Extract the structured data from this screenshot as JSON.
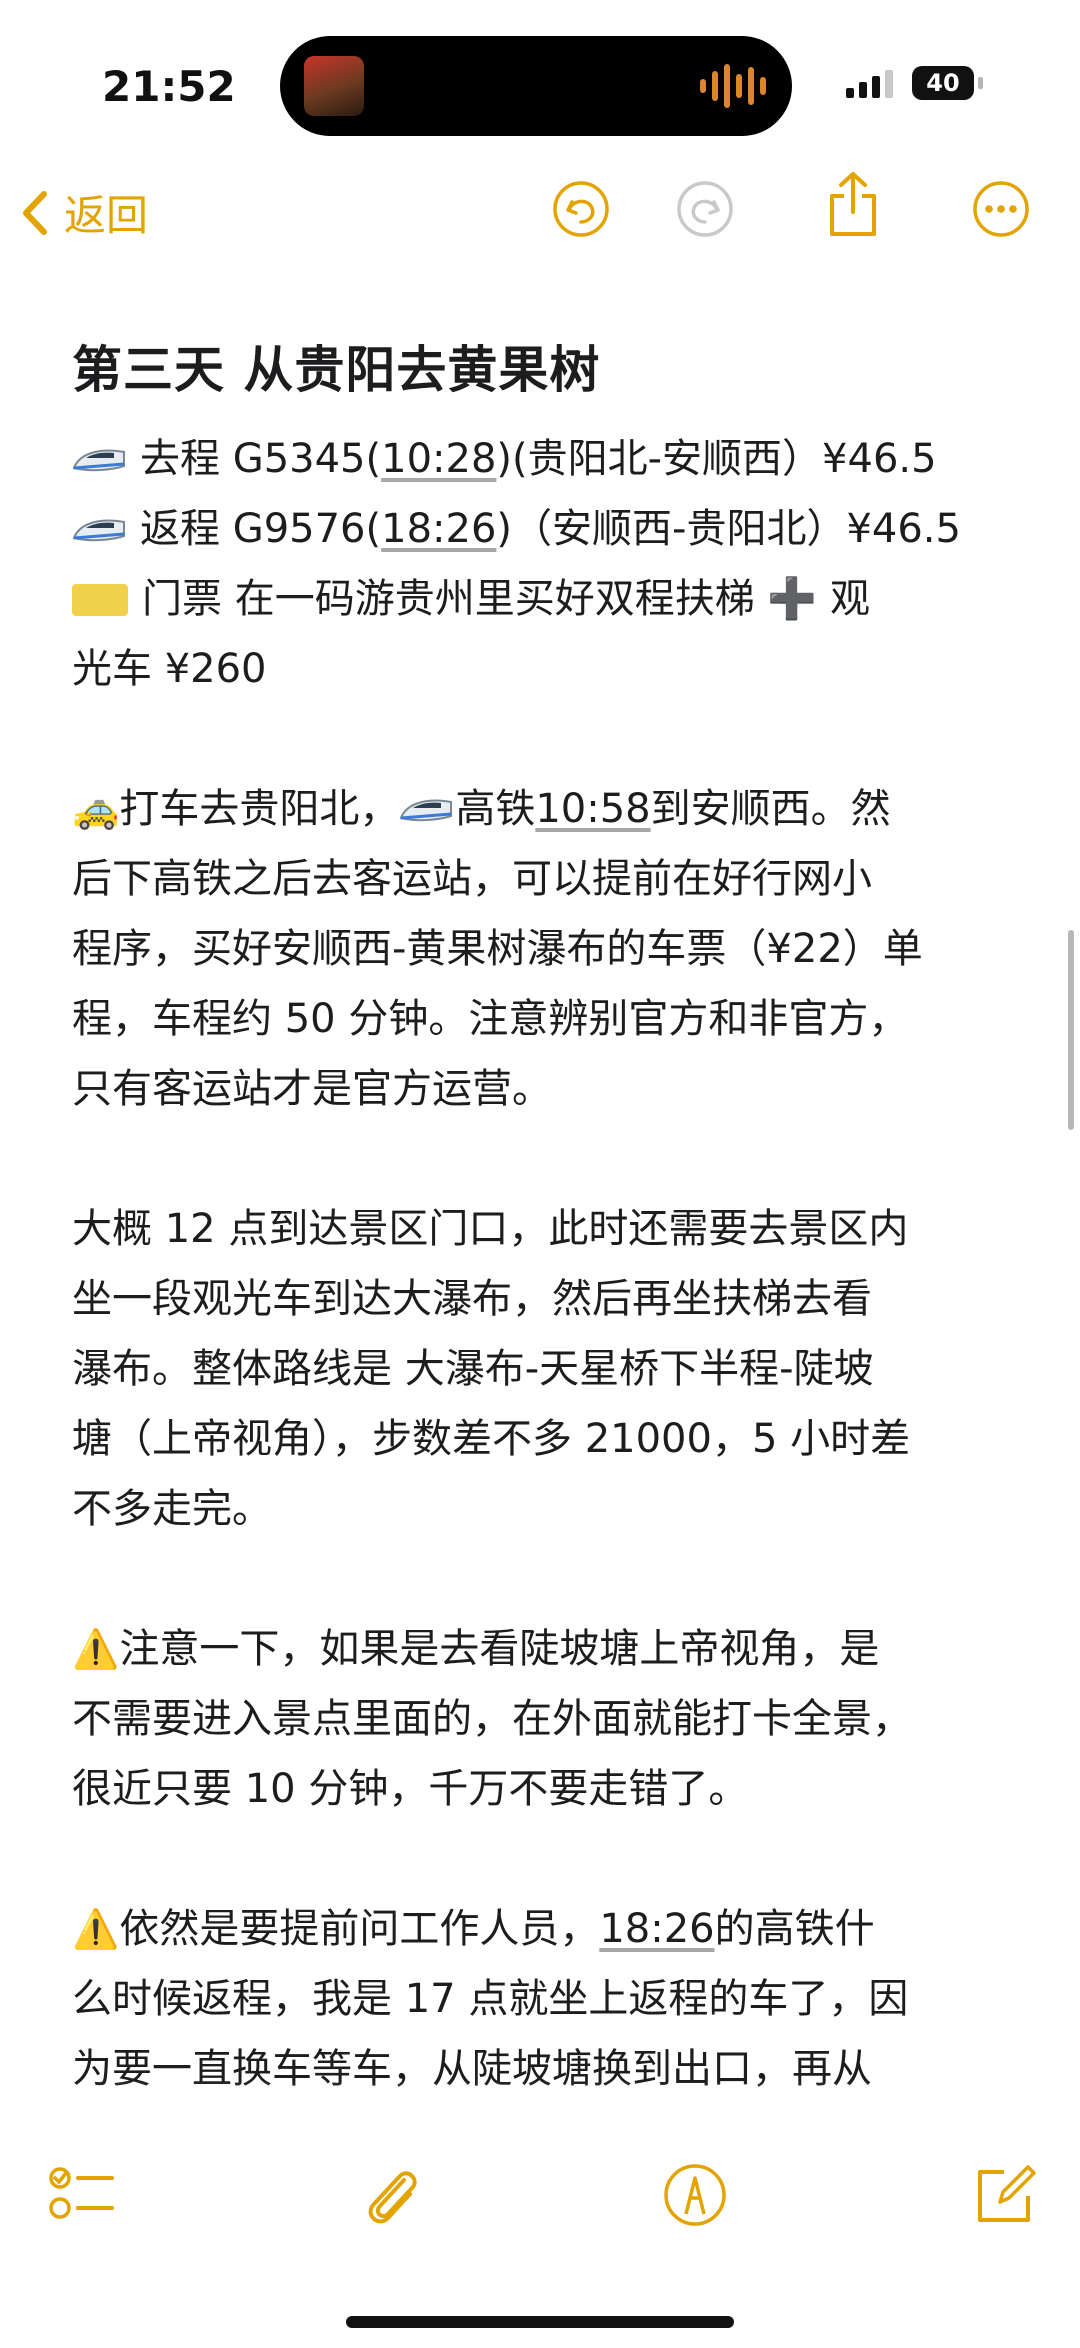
{
  "status_bar": {
    "time": "21:52",
    "battery": "40"
  },
  "nav": {
    "back_label": "返回",
    "icons": [
      "chevron-left-icon",
      "undo-icon",
      "redo-icon",
      "share-icon",
      "more-icon"
    ]
  },
  "note": {
    "title": "第三天 从贵阳去黄果树",
    "outbound": {
      "prefix": "去程 G5345(",
      "time": "10:28",
      "suffix": ")(贵阳北-安顺西）¥46.5"
    },
    "return": {
      "prefix": "返程 G9576(",
      "time": "18:26",
      "suffix": ")（安顺西-贵阳北）¥46.5"
    },
    "ticket_line1": "门票 在一码游贵州里买好双程扶梯 ➕ 观",
    "ticket_line2": "光车 ¥260",
    "p1": {
      "l1a": "打车去贵阳北，",
      "l1b": "高铁",
      "l1time": "10:58",
      "l1c": "到安顺西。然",
      "l2": "后下高铁之后去客运站，可以提前在好行网小",
      "l3": "程序，买好安顺西-黄果树瀑布的车票（¥22）单",
      "l4": "程，车程约 50 分钟。注意辨别官方和非官方，",
      "l5": "只有客运站才是官方运营。"
    },
    "p2": {
      "l1": "大概 12 点到达景区门口，此时还需要去景区内",
      "l2": "坐一段观光车到达大瀑布，然后再坐扶梯去看",
      "l3": "瀑布。整体路线是 大瀑布-天星桥下半程-陡坡",
      "l4": "塘（上帝视角），步数差不多 21000，5 小时差",
      "l5": "不多走完。"
    },
    "p3": {
      "l1": "注意一下，如果是去看陡坡塘上帝视角，是",
      "l2": "不需要进入景点里面的，在外面就能打卡全景，",
      "l3": "很近只要 10 分钟，千万不要走错了。"
    },
    "p4": {
      "l1a": "依然是要提前问工作人员，",
      "l1time": "18:26",
      "l1b": "的高铁什",
      "l2": "么时候返程，我是 17 点就坐上返程的车了，因",
      "l3": "为要一直换车等车，从陡坡塘换到出口，再从"
    }
  },
  "bottom_bar": {
    "icons": [
      "checklist-icon",
      "attachment-icon",
      "markup-icon",
      "compose-icon"
    ]
  },
  "colors": {
    "accent": "#E3A300",
    "text": "#1D1D1F"
  }
}
